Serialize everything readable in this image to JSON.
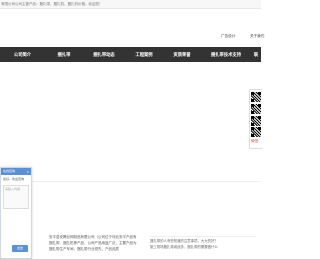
{
  "topbar": {
    "text": "有限公司公司主营产品：捆扎带、捆扎机、捆扎机价格，欢迎您！"
  },
  "header": {
    "links": [
      {
        "label": "广告设计"
      },
      {
        "label": "关于我们"
      }
    ]
  },
  "nav": {
    "items": [
      {
        "label": "公司简介"
      },
      {
        "label": "捆扎带"
      },
      {
        "label": "捆扎带动态"
      },
      {
        "label": "工程案例"
      },
      {
        "label": "资质荣誉"
      },
      {
        "label": "捆扎带技术支持"
      },
      {
        "label": "联"
      }
    ]
  },
  "qr": {
    "label": "微信"
  },
  "dialog": {
    "title": "在线咨询",
    "text": "您好，欢迎咨询",
    "placeholder": "请输入内容",
    "send": "发送"
  },
  "intro": {
    "text": "安平县安腾丝网制品有限公司（公司位于河北安平产品有捆扎带、捆扎机等产品，公司产品用途广泛，主要产品为捆扎带生产车间，捆扎带行业领先，产品品质"
  },
  "news": {
    "items": [
      {
        "label": "捆扎带的人有些知道的注意事项，大大的好？"
      },
      {
        "label": "施工现场捆扎带用途多，捆扎带的需要做什么"
      }
    ]
  },
  "colors": {
    "nav_bg": "#333333",
    "accent": "#5b8fd6",
    "qr_label": "#e43333"
  }
}
